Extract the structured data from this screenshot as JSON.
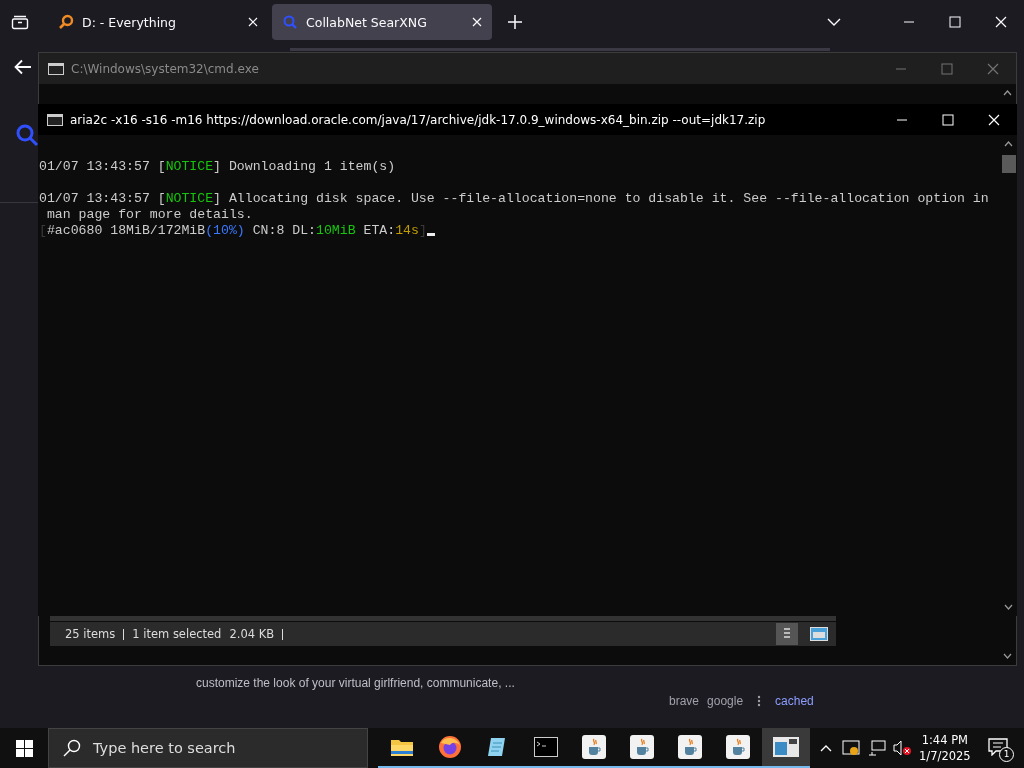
{
  "browser": {
    "tabs": [
      {
        "label": "D: - Everything",
        "selected": false,
        "kind": "magnifier"
      },
      {
        "label": "CollabNet SearXNG",
        "selected": true,
        "kind": "searx"
      }
    ],
    "result": {
      "snippet": "customize the look of your virtual girlfriend, communicate, ...",
      "links": [
        {
          "label": "brave",
          "kind": "engine"
        },
        {
          "label": "google",
          "kind": "engine"
        },
        {
          "label": "cached",
          "kind": "link"
        }
      ]
    }
  },
  "cmd_window": {
    "title": "C:\\Windows\\system32\\cmd.exe"
  },
  "explorer_status": {
    "items": "25 items",
    "selection": "1 item selected",
    "size": "2.04 KB"
  },
  "aria_window": {
    "title": "aria2c  -x16 -s16 -m16 https://download.oracle.com/java/17/archive/jdk-17.0.9_windows-x64_bin.zip --out=jdk17.zip",
    "lines": [
      {
        "blank_before": true,
        "segments": [
          {
            "text": "01/07 13:43:57 [",
            "color": "#cccccc"
          },
          {
            "text": "NOTICE",
            "color": "#16c60c"
          },
          {
            "text": "] Downloading 1 item(s)",
            "color": "#cccccc"
          }
        ]
      },
      {
        "blank_before": true,
        "segments": [
          {
            "text": "01/07 13:43:57 [",
            "color": "#cccccc"
          },
          {
            "text": "NOTICE",
            "color": "#16c60c"
          },
          {
            "text": "] Allocating disk space. Use --file-allocation=none to disable it. See --file-allocation option in",
            "color": "#cccccc"
          }
        ]
      },
      {
        "blank_before": false,
        "segments": [
          {
            "text": " man page for more details.",
            "color": "#cccccc"
          }
        ]
      },
      {
        "blank_before": false,
        "segments": [
          {
            "text": "[",
            "color": "#3a3a3a"
          },
          {
            "text": "#ac0680 18MiB/172MiB",
            "color": "#cccccc"
          },
          {
            "text": "(10%)",
            "color": "#3b78ff"
          },
          {
            "text": " CN:8 DL:",
            "color": "#cccccc"
          },
          {
            "text": "10MiB",
            "color": "#16c60c"
          },
          {
            "text": " ETA:",
            "color": "#cccccc"
          },
          {
            "text": "14s",
            "color": "#c19c00"
          },
          {
            "text": "]",
            "color": "#3a3a3a"
          }
        ],
        "cursor": true
      }
    ]
  },
  "taskbar": {
    "search_placeholder": "Type here to search",
    "apps": [
      {
        "kind": "folder",
        "selected": false
      },
      {
        "kind": "firefox",
        "selected": false
      },
      {
        "kind": "notepad",
        "selected": false
      },
      {
        "kind": "terminal",
        "selected": false
      },
      {
        "kind": "java",
        "selected": false
      },
      {
        "kind": "java",
        "selected": false
      },
      {
        "kind": "java",
        "selected": false
      },
      {
        "kind": "java",
        "selected": false
      },
      {
        "kind": "window",
        "selected": true
      }
    ],
    "time": "1:44 PM",
    "date": "1/7/2025",
    "notifications": "1"
  }
}
